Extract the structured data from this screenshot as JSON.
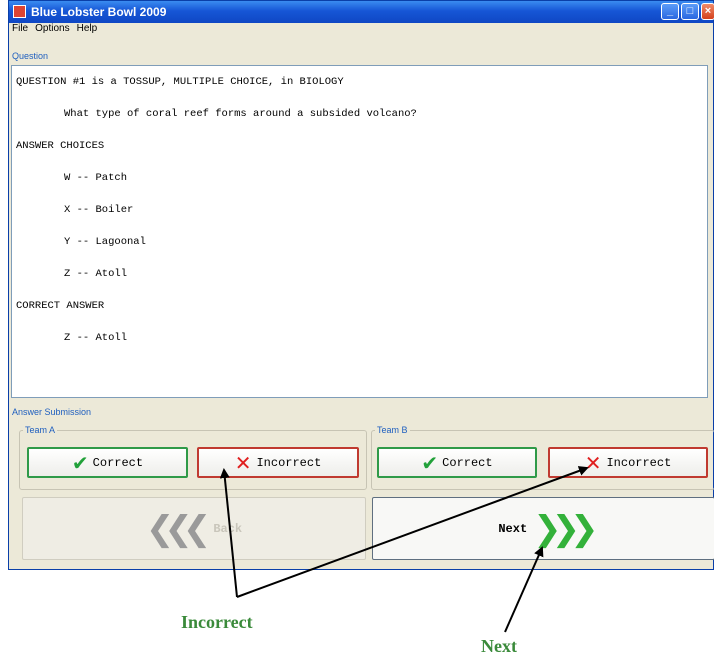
{
  "window": {
    "title": "Blue Lobster Bowl 2009"
  },
  "menu": [
    "File",
    "Options",
    "Help"
  ],
  "question_group": {
    "label": "Question",
    "header": "QUESTION #1 is a TOSSUP, MULTIPLE CHOICE, in BIOLOGY",
    "prompt": "What type of coral reef forms around a subsided volcano?",
    "choices_heading": "ANSWER CHOICES",
    "choices": [
      "W -- Patch",
      "X -- Boiler",
      "Y -- Lagoonal",
      "Z -- Atoll"
    ],
    "correct_heading": "CORRECT ANSWER",
    "correct_answer": "Z -- Atoll"
  },
  "answer_submission": {
    "label": "Answer Submission",
    "team_a": {
      "label": "Team A",
      "correct": "Correct",
      "incorrect": "Incorrect"
    },
    "team_b": {
      "label": "Team B",
      "correct": "Correct",
      "incorrect": "Incorrect"
    }
  },
  "nav": {
    "back": "Back",
    "next": "Next"
  },
  "annotations": {
    "incorrect": "Incorrect",
    "next": "Next"
  },
  "colors": {
    "title_bar": "#1656d6",
    "correct_border": "#2f9a48",
    "incorrect_border": "#c03a30",
    "annotation": "#3a8a3a"
  }
}
